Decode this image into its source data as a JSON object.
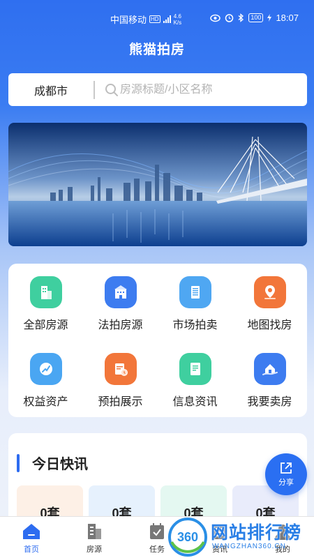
{
  "status_bar": {
    "carrier": "中国移动",
    "network": "HD",
    "net_type": "4G",
    "speed_value": "4.6",
    "speed_unit": "K/s",
    "battery": "100",
    "time": "18:07"
  },
  "app_title": "熊猫拍房",
  "search": {
    "city": "成都市",
    "placeholder": "房源标题/小区名称"
  },
  "menu": {
    "items": [
      {
        "label": "全部房源",
        "icon": "building-icon",
        "color": "#3fcf9f"
      },
      {
        "label": "法拍房源",
        "icon": "court-building-icon",
        "color": "#3d7cf0"
      },
      {
        "label": "市场拍卖",
        "icon": "office-tower-icon",
        "color": "#4fa7f2"
      },
      {
        "label": "地图找房",
        "icon": "map-pin-icon",
        "color": "#f2763a"
      },
      {
        "label": "权益资产",
        "icon": "chart-growth-icon",
        "color": "#4aa6f2"
      },
      {
        "label": "预拍展示",
        "icon": "calendar-clock-icon",
        "color": "#f2763a"
      },
      {
        "label": "信息资讯",
        "icon": "document-icon",
        "color": "#3fcf9f"
      },
      {
        "label": "我要卖房",
        "icon": "house-hand-icon",
        "color": "#3d7cf0"
      }
    ]
  },
  "news": {
    "title": "今日快讯",
    "stats": [
      {
        "value": "0套",
        "bg": "#fdf0e6"
      },
      {
        "value": "0套",
        "bg": "#e6f1fd"
      },
      {
        "value": "0套",
        "bg": "#e4f8f1"
      },
      {
        "value": "0套",
        "bg": "#e9ecfb"
      }
    ]
  },
  "share": {
    "label": "分享"
  },
  "tabs": [
    {
      "label": "首页",
      "icon": "home-icon",
      "active": true
    },
    {
      "label": "房源",
      "icon": "buildings-icon",
      "active": false
    },
    {
      "label": "任务",
      "icon": "task-icon",
      "active": false
    },
    {
      "label": "资讯",
      "icon": "news-icon",
      "active": false
    },
    {
      "label": "我的",
      "icon": "profile-icon",
      "active": false
    }
  ],
  "watermark": {
    "badge": "360",
    "text": "网站排行榜",
    "sub": "WANGZHAN360.CN"
  },
  "colors": {
    "primary": "#2d6cf0",
    "header_bg": "#2f6ff0"
  }
}
